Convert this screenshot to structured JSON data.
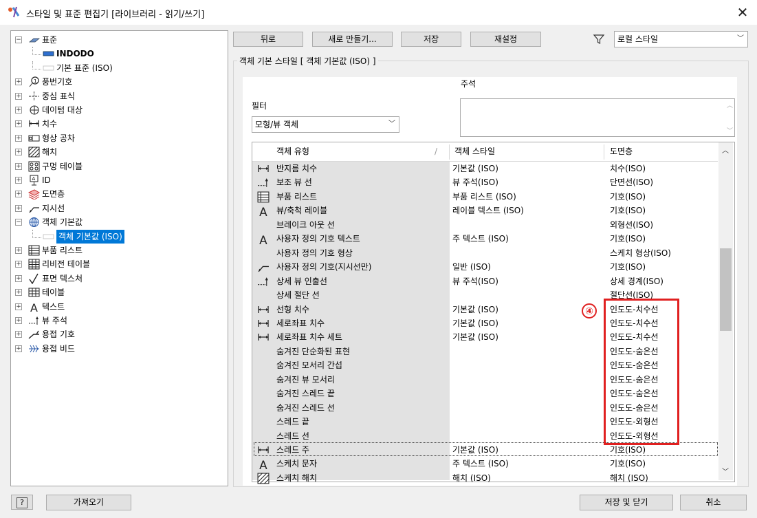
{
  "window": {
    "title": "스타일 및 표준 편집기 [라이브러리 - 읽기/쓰기]"
  },
  "tree": {
    "items": [
      {
        "label": "표준",
        "icon": "standard-icon",
        "pm": "−"
      },
      {
        "label": "INDODO",
        "icon": "standard-blue-icon",
        "bold": true
      },
      {
        "label": "기본 표준 (ISO)",
        "icon": "standard-white-icon"
      },
      {
        "label": "풍번기호",
        "icon": "balloon-icon",
        "pm": "+"
      },
      {
        "label": "중심 표식",
        "icon": "center-mark-icon",
        "pm": "+"
      },
      {
        "label": "데이텀 대상",
        "icon": "datum-target-icon",
        "pm": "+"
      },
      {
        "label": "치수",
        "icon": "dimension-icon",
        "pm": "+"
      },
      {
        "label": "형상 공차",
        "icon": "feature-control-icon",
        "pm": "+"
      },
      {
        "label": "해치",
        "icon": "hatch-icon",
        "pm": "+"
      },
      {
        "label": "구멍 테이블",
        "icon": "hole-table-icon",
        "pm": "+"
      },
      {
        "label": "ID",
        "icon": "id-icon",
        "pm": "+"
      },
      {
        "label": "도면층",
        "icon": "layers-icon",
        "pm": "+"
      },
      {
        "label": "지시선",
        "icon": "leader-icon",
        "pm": "+"
      },
      {
        "label": "객체 기본값",
        "icon": "object-defaults-icon",
        "pm": "−"
      },
      {
        "label": "객체 기본값 (ISO)",
        "icon": "object-default-item-icon",
        "selected": true
      },
      {
        "label": "부품 리스트",
        "icon": "parts-list-icon",
        "pm": "+"
      },
      {
        "label": "리비전 테이블",
        "icon": "revision-table-icon",
        "pm": "+"
      },
      {
        "label": "표면 텍스처",
        "icon": "surface-texture-icon",
        "pm": "+"
      },
      {
        "label": "테이블",
        "icon": "table-icon",
        "pm": "+"
      },
      {
        "label": "텍스트",
        "icon": "text-icon",
        "pm": "+"
      },
      {
        "label": "뷰 주석",
        "icon": "view-annotation-icon",
        "pm": "+"
      },
      {
        "label": "용접 기호",
        "icon": "weld-symbol-icon",
        "pm": "+"
      },
      {
        "label": "용접 비드",
        "icon": "weld-bead-icon",
        "pm": "+"
      }
    ]
  },
  "toolbar": {
    "back": "뒤로",
    "new": "새로 만들기...",
    "save": "저장",
    "reset": "재설정",
    "filter_select": "로컬 스타일"
  },
  "group": {
    "title": "객체 기본 스타일 [ 객체 기본값 (ISO) ]"
  },
  "notes": {
    "label": "주석",
    "value": ""
  },
  "filter": {
    "label": "필터",
    "value": "모형/뷰 객체"
  },
  "table": {
    "headers": [
      "객체 유형",
      "객체 스타일",
      "도면층"
    ],
    "rows": [
      {
        "icon": "dimension-icon",
        "type": "반지름 치수",
        "style": "기본값 (ISO)",
        "layer": "치수(ISO)"
      },
      {
        "icon": "view-annotation-icon",
        "type": "보조 뷰 선",
        "style": "뷰 주석(ISO)",
        "layer": "단면선(ISO)"
      },
      {
        "icon": "parts-list-icon",
        "type": "부품 리스트",
        "style": "부품 리스트 (ISO)",
        "layer": "기호(ISO)"
      },
      {
        "icon": "text-icon",
        "type": "뷰/축척 레이블",
        "style": "레이블 텍스트 (ISO)",
        "layer": "기호(ISO)"
      },
      {
        "icon": "",
        "type": "브레이크 아웃 선",
        "style": "",
        "layer": "외형선(ISO)"
      },
      {
        "icon": "text-icon",
        "type": "사용자 정의 기호 텍스트",
        "style": "주 텍스트 (ISO)",
        "layer": "기호(ISO)"
      },
      {
        "icon": "",
        "type": "사용자 정의 기호 형상",
        "style": "",
        "layer": "스케치 형상(ISO)"
      },
      {
        "icon": "leader-icon",
        "type": "사용자 정의 기호(지시선만)",
        "style": "일반 (ISO)",
        "layer": "기호(ISO)"
      },
      {
        "icon": "view-annotation-icon",
        "type": "상세 뷰 인출선",
        "style": "뷰 주석(ISO)",
        "layer": "상세 경계(ISO)"
      },
      {
        "icon": "",
        "type": "상세 절단 선",
        "style": "",
        "layer": "절단선(ISO)"
      },
      {
        "icon": "dimension-icon",
        "type": "선형 치수",
        "style": "기본값 (ISO)",
        "layer": "인도도-치수선"
      },
      {
        "icon": "dimension-icon",
        "type": "세로좌표 치수",
        "style": "기본값 (ISO)",
        "layer": "인도도-치수선"
      },
      {
        "icon": "dimension-icon",
        "type": "세로좌표 치수 세트",
        "style": "기본값 (ISO)",
        "layer": "인도도-치수선"
      },
      {
        "icon": "",
        "type": "숨겨진 단순화된 표현",
        "style": "",
        "layer": "인도도-숨은선"
      },
      {
        "icon": "",
        "type": "숨겨진 모서리 간섭",
        "style": "",
        "layer": "인도도-숨은선"
      },
      {
        "icon": "",
        "type": "숨겨진 뷰 모서리",
        "style": "",
        "layer": "인도도-숨은선"
      },
      {
        "icon": "",
        "type": "숨겨진 스레드 끝",
        "style": "",
        "layer": "인도도-숨은선"
      },
      {
        "icon": "",
        "type": "숨겨진 스레드 선",
        "style": "",
        "layer": "인도도-숨은선"
      },
      {
        "icon": "",
        "type": "스레드 끝",
        "style": "",
        "layer": "인도도-외형선"
      },
      {
        "icon": "",
        "type": "스레드 선",
        "style": "",
        "layer": "인도도-외형선"
      },
      {
        "icon": "dimension-icon",
        "type": "스레드 주",
        "style": "기본값 (ISO)",
        "layer": "기호(ISO)"
      },
      {
        "icon": "text-icon",
        "type": "스케치 문자",
        "style": "주 텍스트 (ISO)",
        "layer": "기호(ISO)"
      },
      {
        "icon": "hatch-icon",
        "type": "스케치 해치",
        "style": "해치 (ISO)",
        "layer": "해치 (ISO)"
      }
    ]
  },
  "annotation": {
    "marker": "④",
    "color": "#e02020"
  },
  "bottom": {
    "help": "?",
    "import": "가져오기",
    "save_close": "저장 및 닫기",
    "cancel": "취소"
  },
  "colors": {
    "selection": "#0078d7",
    "button": "#e1e1e1",
    "column_shade": "#e2e2e2"
  }
}
